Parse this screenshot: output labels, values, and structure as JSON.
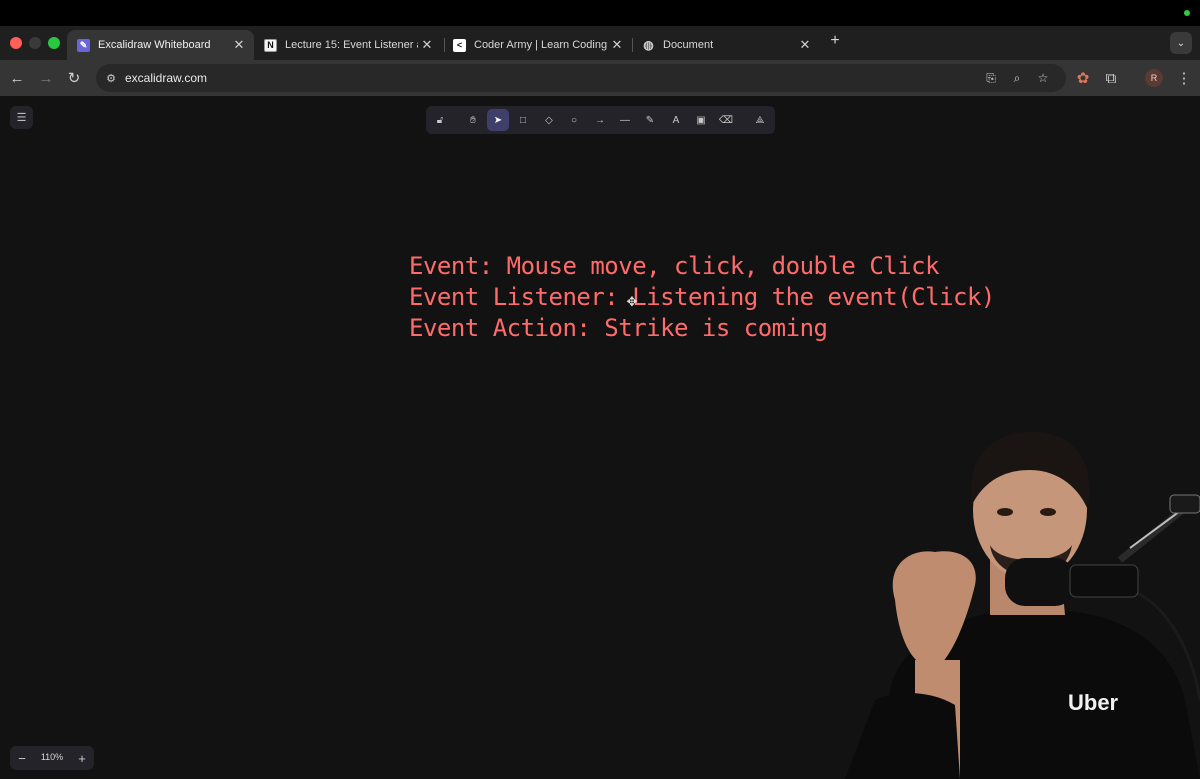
{
  "browser": {
    "tabs": [
      {
        "title": "Excalidraw Whiteboard",
        "close": "✕",
        "favicon": "excalidraw-icon"
      },
      {
        "title": "Lecture 15: Event Listener and",
        "close": "✕",
        "favicon": "notion-icon"
      },
      {
        "title": "Coder Army | Learn Coding in",
        "close": "✕",
        "favicon": "coder-army-icon"
      },
      {
        "title": "Document",
        "close": "✕",
        "favicon": "globe-icon"
      }
    ],
    "new_tab": "+",
    "url": "excalidraw.com",
    "profile_initial": "R"
  },
  "canvas": {
    "lines": [
      "Event: Mouse move, click, double Click",
      "Event Listener: Listening the event(Click)",
      "Event Action: Strike is coming"
    ],
    "text_color": "#ff6b6b",
    "zoom_level": "110%",
    "zoom_out": "−",
    "zoom_in": "+"
  },
  "presenter": {
    "shirt_text": "Uber"
  }
}
